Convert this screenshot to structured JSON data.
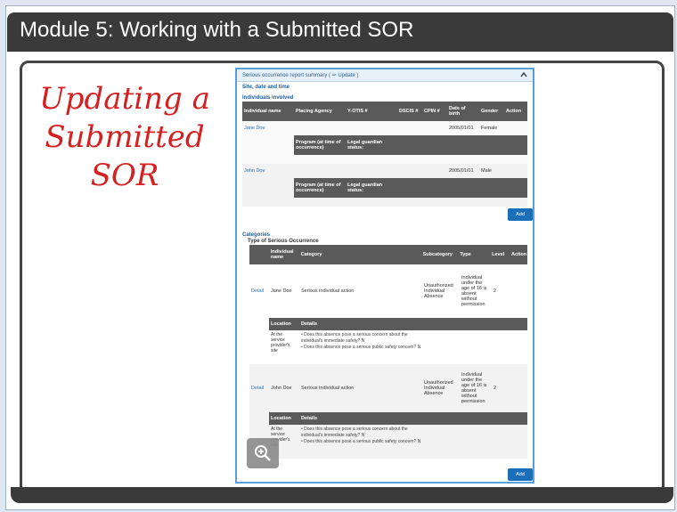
{
  "slide": {
    "title": "Module 5:  Working with a Submitted SOR",
    "handwritten": [
      "Updating a",
      "Submitted",
      "SOR"
    ]
  },
  "panel": {
    "header": "Serious occurrence report summary ( ✏ Update )",
    "collapse_icon": "chevron-up-icon",
    "site_label": "Site, date and time",
    "individuals_label": "Individuals involved",
    "individuals_headers": [
      "Individual name",
      "Placing Agency",
      "Y-OTIS #",
      "DSCIS #",
      "CPIN #",
      "Date of birth",
      "Gender",
      "Action"
    ],
    "sub_headers": [
      "Program (at time of occurrence)",
      "Legal guardian status:"
    ],
    "individuals": [
      {
        "name": "Jane Doe",
        "dob": "2005/01/01",
        "gender": "Female"
      },
      {
        "name": "John Doe",
        "dob": "2005/01/01",
        "gender": "Male"
      }
    ],
    "add_label": "Add",
    "categories_label": "Categories",
    "type_label": "Type of Serious Occurrence",
    "category_headers": [
      "Individual name",
      "Category",
      "Subcategory",
      "Type",
      "Level",
      "Action"
    ],
    "categories": [
      {
        "detail": "Detail",
        "name": "Jane Doe",
        "category": "Serious individual action",
        "subcategory": "Unauthorized Individual Absence",
        "type": "Individual under the age of 16 is absent without permission",
        "level": "2"
      },
      {
        "detail": "Detail",
        "name": "John Doe",
        "category": "Serious individual action",
        "subcategory": "Unauthorized Individual Absence",
        "type": "Individual under the age of 16 is absent without permission",
        "level": "2"
      }
    ],
    "location_headers": [
      "Location",
      "Details"
    ],
    "location_value": "At the service provider's site",
    "details": [
      "Does this absence pose a serious concern about the individual's immediate safety? N",
      "Does this absence pose a serious public safety concern? N"
    ]
  },
  "icons": {
    "zoom": "zoom-in-icon"
  }
}
